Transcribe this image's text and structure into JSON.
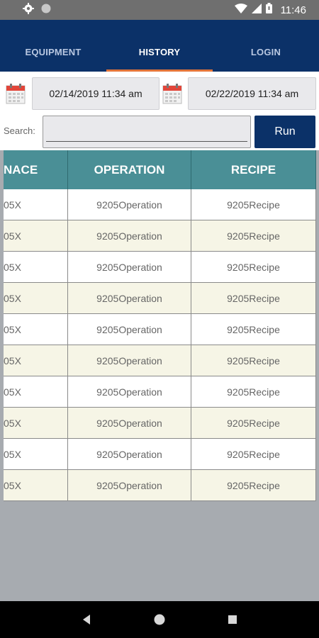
{
  "status_bar": {
    "time": "11:46",
    "icons": [
      "gear-icon",
      "circle-icon",
      "wifi-icon",
      "signal-icon",
      "battery-icon"
    ]
  },
  "header": {
    "tabs": [
      {
        "label": "EQUIPMENT",
        "active": false
      },
      {
        "label": "HISTORY",
        "active": true
      },
      {
        "label": "LOGIN",
        "active": false
      }
    ],
    "accent_color": "#e3753a",
    "bg_color": "#0b3168"
  },
  "filters": {
    "start_date": "02/14/2019 11:34 am",
    "end_date": "02/22/2019 11:34 am",
    "search_label": "Search:",
    "search_value": "",
    "run_label": "Run"
  },
  "table": {
    "headers": [
      "NACE",
      "OPERATION",
      "RECIPE"
    ],
    "header_color": "#4a8f96",
    "rows": [
      [
        "05X",
        "9205Operation",
        "9205Recipe"
      ],
      [
        "05X",
        "9205Operation",
        "9205Recipe"
      ],
      [
        "05X",
        "9205Operation",
        "9205Recipe"
      ],
      [
        "05X",
        "9205Operation",
        "9205Recipe"
      ],
      [
        "05X",
        "9205Operation",
        "9205Recipe"
      ],
      [
        "05X",
        "9205Operation",
        "9205Recipe"
      ],
      [
        "05X",
        "9205Operation",
        "9205Recipe"
      ],
      [
        "05X",
        "9205Operation",
        "9205Recipe"
      ],
      [
        "05X",
        "9205Operation",
        "9205Recipe"
      ],
      [
        "05X",
        "9205Operation",
        "9205Recipe"
      ]
    ]
  },
  "nav_bar": {
    "buttons": [
      "back-icon",
      "home-icon",
      "recents-icon"
    ]
  }
}
